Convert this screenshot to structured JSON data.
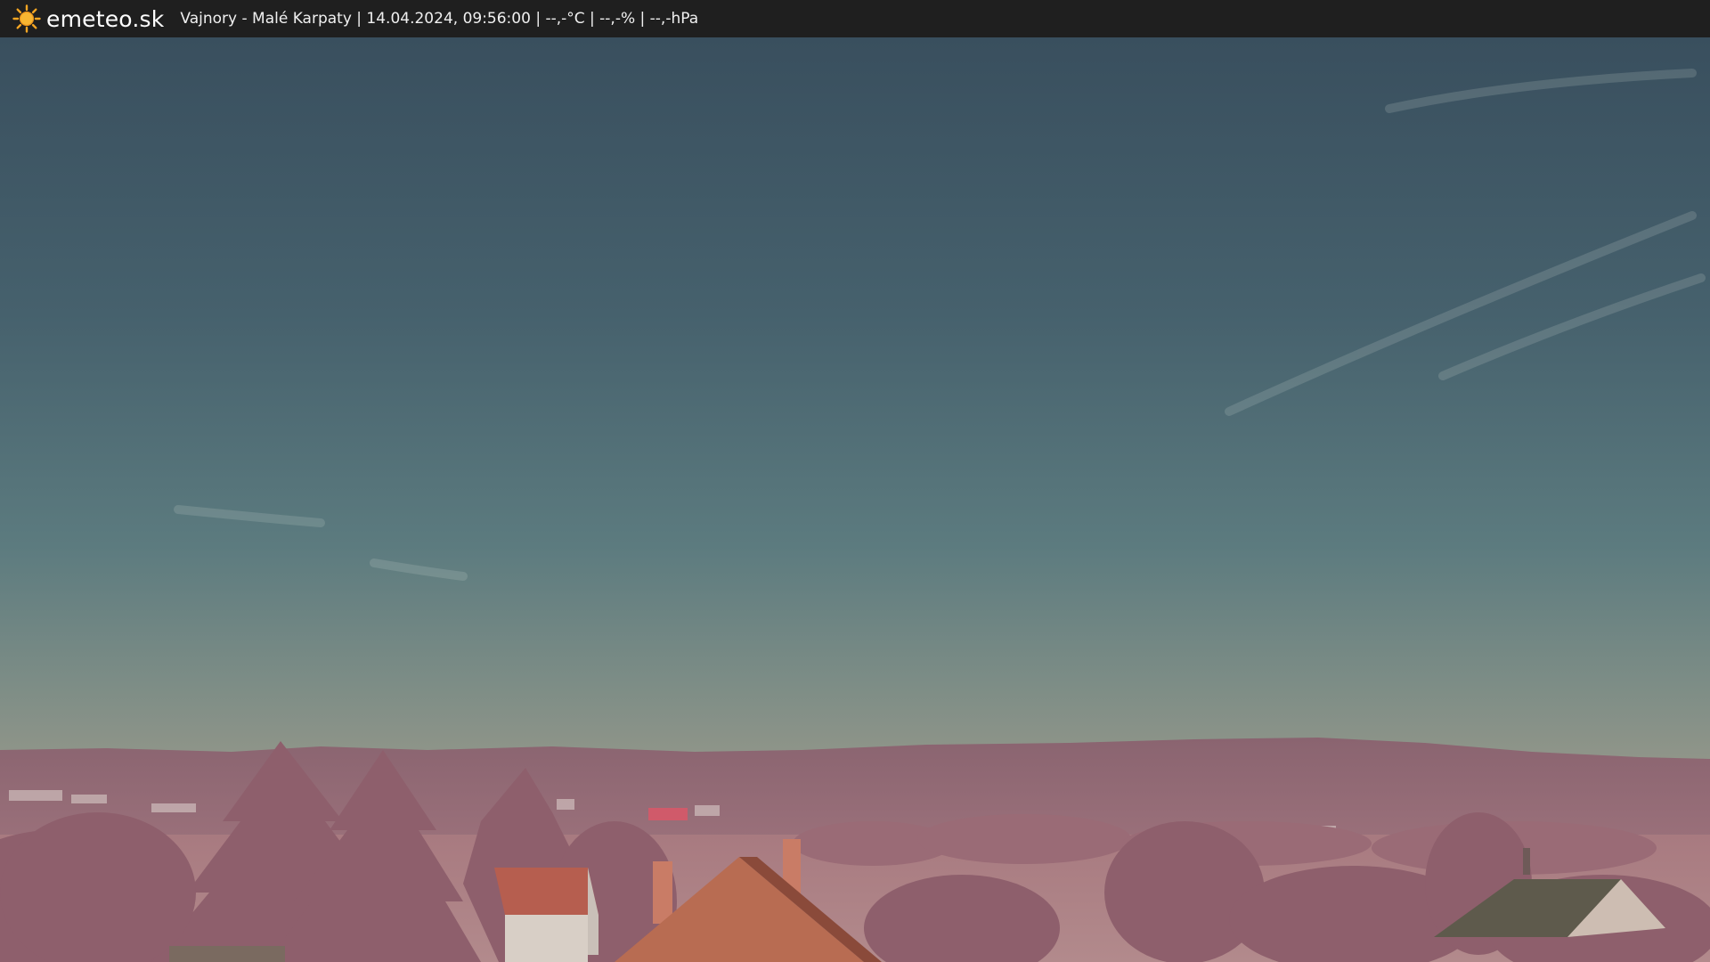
{
  "header": {
    "logo_text": "emeteo.sk",
    "caption": "Vajnory - Malé Karpaty | 14.04.2024, 09:56:00 | --,-°C | --,-% | --,-hPa",
    "logo_icon": "sun-icon"
  },
  "colors": {
    "bar_background": "#1f1f1f",
    "sun": "#f5a623",
    "sky_top": "#3a5565",
    "sky_mid": "#5b7b80",
    "sky_horizon": "#a39e8d",
    "hills": "#8b6470",
    "trees": "#9e6d78",
    "roof": "#b76b50"
  }
}
